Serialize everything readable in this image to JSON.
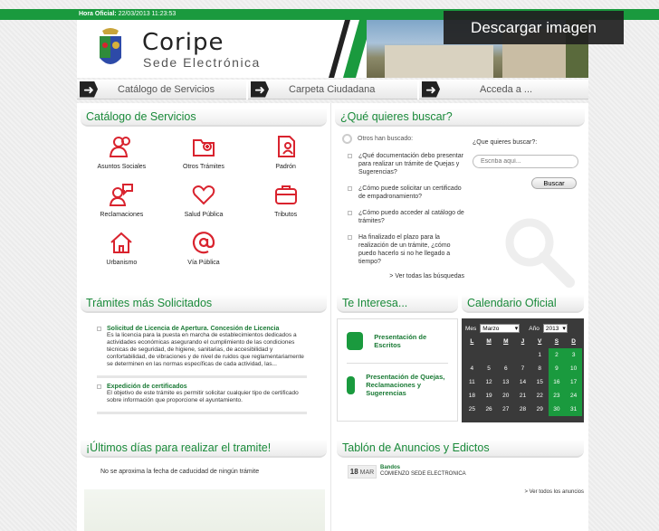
{
  "topbar": {
    "label": "Hora Oficial:",
    "datetime": "22/03/2013 11:23:53"
  },
  "header": {
    "title": "Coripe",
    "subtitle": "Sede Electrónica"
  },
  "download_button": "Descargar imagen",
  "nav": [
    {
      "label": "Catálogo de Servicios"
    },
    {
      "label": "Carpeta Ciudadana"
    },
    {
      "label": "Acceda a ..."
    }
  ],
  "catalogo": {
    "title": "Catálogo de Servicios",
    "items": [
      {
        "label": "Asuntos Sociales",
        "icon": "people-icon"
      },
      {
        "label": "Otros Trámites",
        "icon": "folder-plus-icon"
      },
      {
        "label": "Padrón",
        "icon": "document-person-icon"
      },
      {
        "label": "Reclamaciones",
        "icon": "person-speech-icon"
      },
      {
        "label": "Salud Pública",
        "icon": "heart-icon"
      },
      {
        "label": "Tributos",
        "icon": "briefcase-icon"
      },
      {
        "label": "Urbanismo",
        "icon": "house-icon"
      },
      {
        "label": "Vía Pública",
        "icon": "at-sign-icon"
      }
    ]
  },
  "buscar": {
    "title": "¿Qué quieres buscar?",
    "otros": "Otros han buscado:",
    "queries": [
      "¿Qué documentación debo presentar para realizar un trámite de Quejas y Sugerencias?",
      "¿Cómo puede solicitar un certificado de empadronamiento?",
      "¿Cómo puedo acceder al catálogo de trámites?",
      "Ha finalizado el plazo para la realización de un trámite, ¿cómo puedo hacerlo si no he llegado a tiempo?"
    ],
    "ver_todas": "> Ver todas las búsquedas",
    "label": "¿Que quieres buscar?:",
    "placeholder": "Escriba aquí...",
    "button": "Buscar"
  },
  "tramites": {
    "title": "Trámites más Solicitados",
    "items": [
      {
        "title": "Solicitud de Licencia de Apertura. Concesión de Licencia",
        "desc": "Es la licencia para la puesta en marcha de establecimientos dedicados a actividades económicas asegurando el cumplimiento de las condiciones técnicas de seguridad, de higiene, sanitarias, de accesibilidad y confortabilidad, de vibraciones y de nivel de ruidos que reglamentariamente se determinen en las normas específicas de cada actividad, las..."
      },
      {
        "title": "Expedición de certificados",
        "desc": "El objetivo de este trámite es permitir solicitar cualquier tipo de certificado sobre información que proporcione el ayuntamiento."
      }
    ]
  },
  "interesa": {
    "title": "Te Interesa...",
    "items": [
      {
        "label": "Presentación de Escritos"
      },
      {
        "label": "Presentación de Quejas, Reclamaciones y Sugerencias"
      }
    ]
  },
  "calendario": {
    "title": "Calendario Oficial",
    "mes_label": "Mes",
    "mes": "Marzo",
    "anio_label": "Año",
    "anio": "2013",
    "days": [
      "L",
      "M",
      "M",
      "J",
      "V",
      "S",
      "D"
    ],
    "cells": [
      "",
      "",
      "",
      "",
      "1",
      "2",
      "3",
      "4",
      "5",
      "6",
      "7",
      "8",
      "9",
      "10",
      "11",
      "12",
      "13",
      "14",
      "15",
      "16",
      "17",
      "18",
      "19",
      "20",
      "21",
      "22",
      "23",
      "24",
      "25",
      "26",
      "27",
      "28",
      "29",
      "30",
      "31"
    ]
  },
  "ultimos": {
    "title": "¡Últimos días para realizar el tramite!",
    "text": "No se aproxima la fecha de caducidad de ningún trámite"
  },
  "tablon": {
    "title": "Tablón de Anuncios y Edictos",
    "items": [
      {
        "day": "18",
        "month": "MAR",
        "title": "Bandos",
        "desc": "COMIENZO SEDE ELECTRONICA"
      }
    ],
    "ver_todos": "> Ver todos los anuncios"
  },
  "colors": {
    "green": "#1a9a3e",
    "red": "#d9232e"
  }
}
